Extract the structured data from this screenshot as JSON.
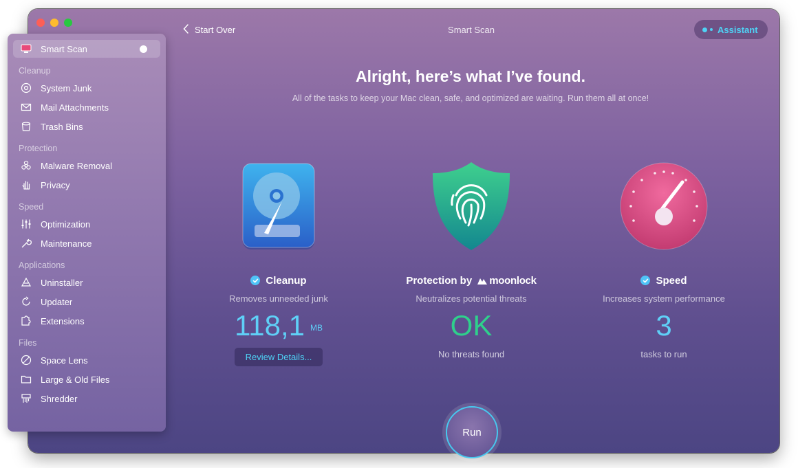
{
  "window": {
    "title": "Smart Scan"
  },
  "topbar": {
    "back_label": "Start Over",
    "title": "Smart Scan",
    "assistant_label": "Assistant"
  },
  "sidebar": {
    "active_item": {
      "label": "Smart Scan",
      "icon": "smart-scan-icon"
    },
    "sections": [
      {
        "heading": "Cleanup",
        "items": [
          {
            "label": "System Junk",
            "icon": "system-junk-icon"
          },
          {
            "label": "Mail Attachments",
            "icon": "mail-icon"
          },
          {
            "label": "Trash Bins",
            "icon": "trash-icon"
          }
        ]
      },
      {
        "heading": "Protection",
        "items": [
          {
            "label": "Malware Removal",
            "icon": "biohazard-icon"
          },
          {
            "label": "Privacy",
            "icon": "hand-icon"
          }
        ]
      },
      {
        "heading": "Speed",
        "items": [
          {
            "label": "Optimization",
            "icon": "sliders-icon"
          },
          {
            "label": "Maintenance",
            "icon": "wrench-icon"
          }
        ]
      },
      {
        "heading": "Applications",
        "items": [
          {
            "label": "Uninstaller",
            "icon": "uninstaller-icon"
          },
          {
            "label": "Updater",
            "icon": "updater-icon"
          },
          {
            "label": "Extensions",
            "icon": "puzzle-icon"
          }
        ]
      },
      {
        "heading": "Files",
        "items": [
          {
            "label": "Space Lens",
            "icon": "space-lens-icon"
          },
          {
            "label": "Large & Old Files",
            "icon": "folder-icon"
          },
          {
            "label": "Shredder",
            "icon": "shredder-icon"
          }
        ]
      }
    ]
  },
  "main": {
    "headline": "Alright, here’s what I’ve found.",
    "subheadline": "All of the tasks to keep your Mac clean, safe, and optimized are waiting. Run them all at once!",
    "cleanup": {
      "title": "Cleanup",
      "subtitle": "Removes unneeded junk",
      "value": "118,1",
      "unit": "MB",
      "button": "Review Details...",
      "icon": "hard-drive-icon"
    },
    "protection": {
      "title": "Protection by",
      "brand": "moonlock",
      "subtitle": "Neutralizes potential threats",
      "value": "OK",
      "note": "No threats found",
      "icon": "fingerprint-shield-icon"
    },
    "speed": {
      "title": "Speed",
      "subtitle": "Increases system performance",
      "value": "3",
      "note": "tasks to run",
      "icon": "speedometer-icon"
    }
  },
  "run_button": {
    "label": "Run"
  },
  "colors": {
    "accent": "#4fd2f5",
    "ok_green": "#2fd08c",
    "value_blue": "#5fd0f7"
  }
}
